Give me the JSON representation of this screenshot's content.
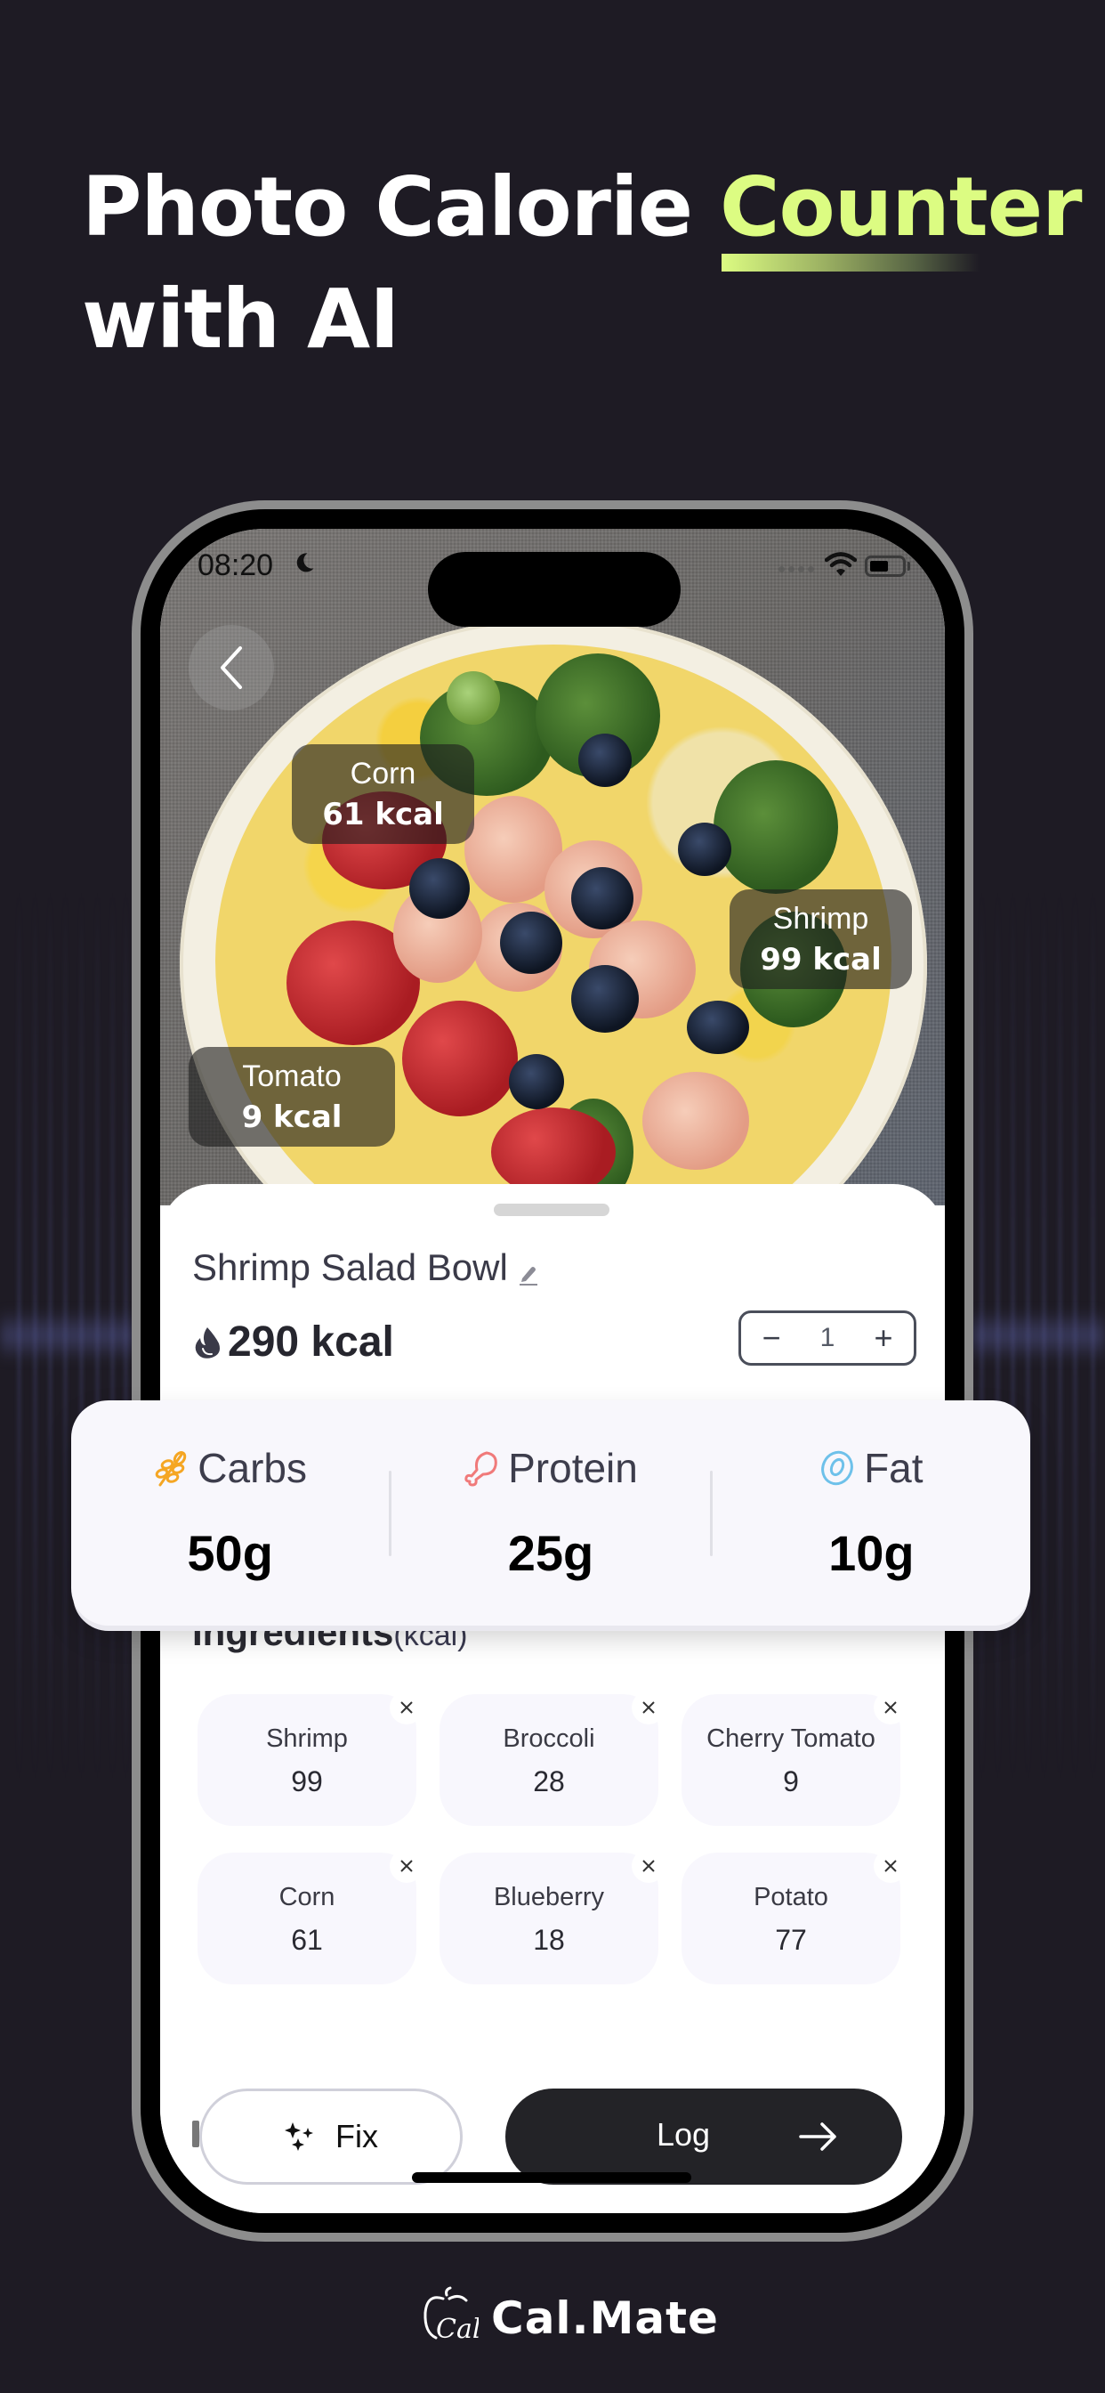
{
  "headline": {
    "line1_prefix": "Photo Calorie",
    "line1_accent": "Counter",
    "line2": "with AI",
    "accent_color": "#dcfc82"
  },
  "status_bar": {
    "time": "08:20",
    "icons": [
      "moon-icon",
      "signal-icon",
      "wifi-icon",
      "battery-icon"
    ]
  },
  "photo": {
    "back_icon": "chevron-left-icon",
    "tags": [
      {
        "name": "Corn",
        "kcal": "61 kcal"
      },
      {
        "name": "Shrimp",
        "kcal": "99 kcal"
      },
      {
        "name": "Tomato",
        "kcal": "9 kcal"
      }
    ]
  },
  "meal": {
    "title": "Shrimp Salad Bowl",
    "edit_icon": "pencil-icon",
    "calories": "290 kcal",
    "calorie_icon": "flame-icon",
    "quantity": "1",
    "decrement": "−",
    "increment": "+"
  },
  "macros": [
    {
      "label": "Carbs",
      "value": "50g",
      "icon": "wheat-icon",
      "color": "#f5a623"
    },
    {
      "label": "Protein",
      "value": "25g",
      "icon": "drumstick-icon",
      "color": "#f07a7a"
    },
    {
      "label": "Fat",
      "value": "10g",
      "icon": "fat-drop-icon",
      "color": "#6ec1ea"
    }
  ],
  "ingredients": {
    "title": "Ingredients",
    "unit": "(kcal)",
    "items": [
      {
        "name": "Shrimp",
        "kcal": "99"
      },
      {
        "name": "Broccoli",
        "kcal": "28"
      },
      {
        "name": "Cherry Tomato",
        "kcal": "9"
      },
      {
        "name": "Corn",
        "kcal": "61"
      },
      {
        "name": "Blueberry",
        "kcal": "18"
      },
      {
        "name": "Potato",
        "kcal": "77"
      }
    ]
  },
  "actions": {
    "fix_label": "Fix",
    "fix_icon": "sparkles-icon",
    "log_label": "Log",
    "log_icon": "arrow-right-icon"
  },
  "brand": {
    "name": "Cal.Mate",
    "mark_text": "Cal"
  }
}
